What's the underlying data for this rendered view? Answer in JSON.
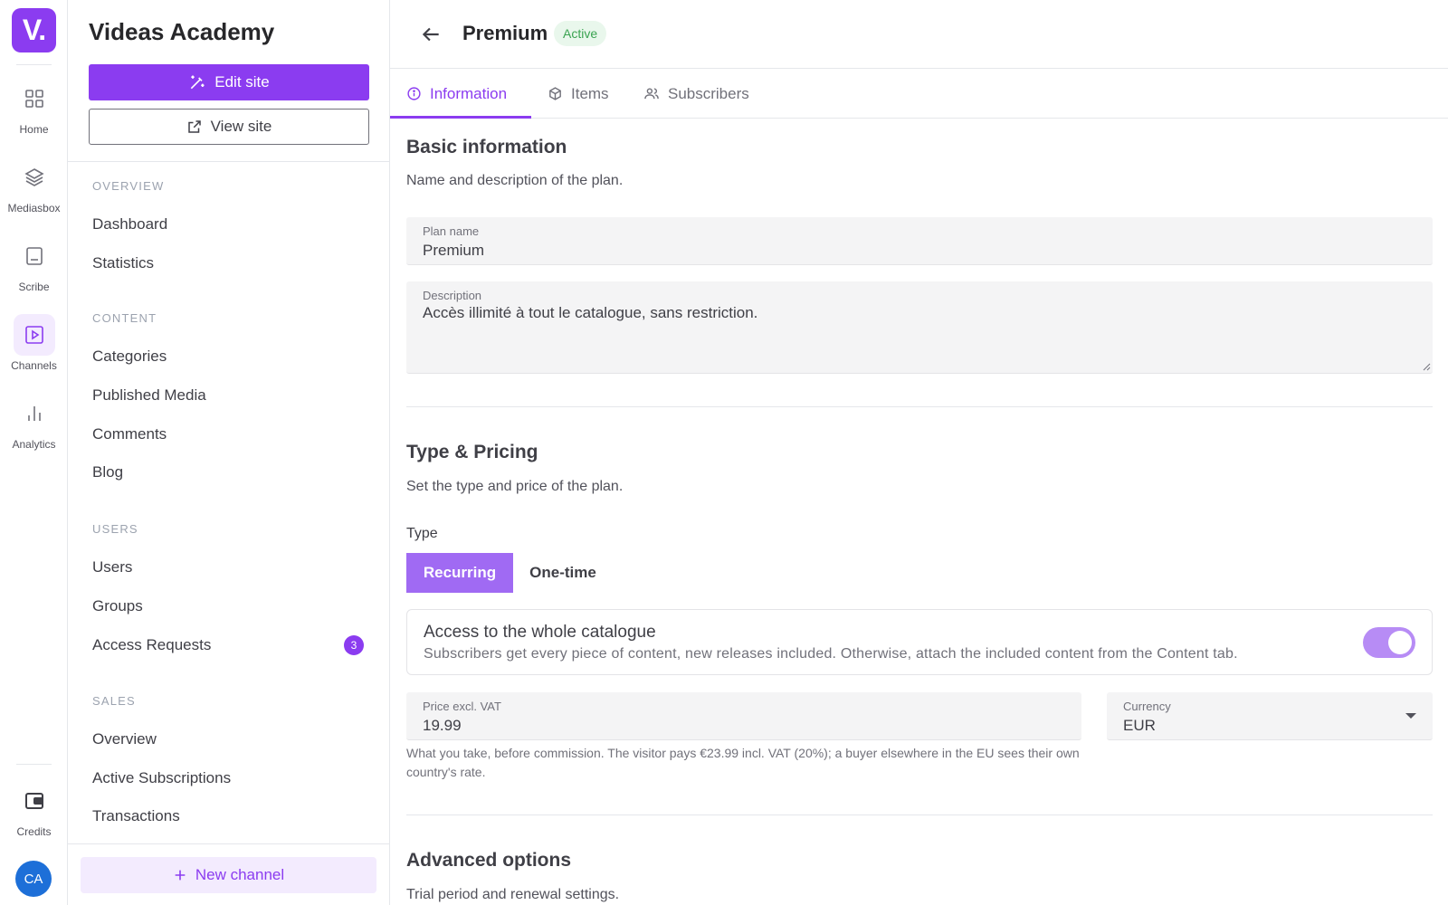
{
  "rail": {
    "logo": "V.",
    "items": [
      {
        "label": "Home",
        "icon": "grid-icon"
      },
      {
        "label": "Mediasbox",
        "icon": "layers-icon"
      },
      {
        "label": "Scribe",
        "icon": "subtitles-icon"
      },
      {
        "label": "Channels",
        "icon": "play-square-icon"
      },
      {
        "label": "Analytics",
        "icon": "bar-chart-icon"
      }
    ],
    "credits_label": "Credits",
    "avatar_initials": "CA"
  },
  "sidebar": {
    "site_title": "Videas Academy",
    "edit_site_label": "Edit site",
    "view_site_label": "View site",
    "sections": [
      {
        "title": "OVERVIEW",
        "items": [
          "Dashboard",
          "Statistics"
        ]
      },
      {
        "title": "CONTENT",
        "items": [
          "Categories",
          "Published Media",
          "Comments",
          "Blog"
        ]
      },
      {
        "title": "USERS",
        "items": [
          "Users",
          "Groups",
          "Access Requests"
        ]
      },
      {
        "title": "SALES",
        "items": [
          "Overview",
          "Active Subscriptions",
          "Transactions"
        ]
      }
    ],
    "access_requests_count": "3",
    "new_channel_label": "New channel"
  },
  "header": {
    "title": "Premium",
    "status": "Active"
  },
  "tabs": [
    {
      "label": "Information",
      "icon": "info-icon"
    },
    {
      "label": "Items",
      "icon": "box-icon"
    },
    {
      "label": "Subscribers",
      "icon": "users-icon"
    }
  ],
  "basic": {
    "title": "Basic information",
    "subtitle": "Name and description of the plan.",
    "plan_name_label": "Plan name",
    "plan_name_value": "Premium",
    "description_label": "Description",
    "description_value": "Accès illimité à tout le catalogue, sans restriction."
  },
  "pricing": {
    "title": "Type & Pricing",
    "subtitle": "Set the type and price of the plan.",
    "type_label": "Type",
    "type_options": [
      "Recurring",
      "One-time"
    ],
    "selected_type": "Recurring",
    "catalogue_title": "Access to the whole catalogue",
    "catalogue_desc": "Subscribers get every piece of content, new releases included. Otherwise, attach the included content from the Content tab.",
    "catalogue_enabled": true,
    "price_label": "Price excl. VAT",
    "price_value": "19.99",
    "currency_label": "Currency",
    "currency_value": "EUR",
    "price_hint": "What you take, before commission. The visitor pays €23.99 incl. VAT (20%); a buyer elsewhere in the EU sees their own country's rate."
  },
  "advanced": {
    "title": "Advanced options",
    "subtitle": "Trial period and renewal settings."
  },
  "colors": {
    "accent": "#8b3cf0",
    "accent_light": "#f3ebfe",
    "success": "#3aa351"
  }
}
